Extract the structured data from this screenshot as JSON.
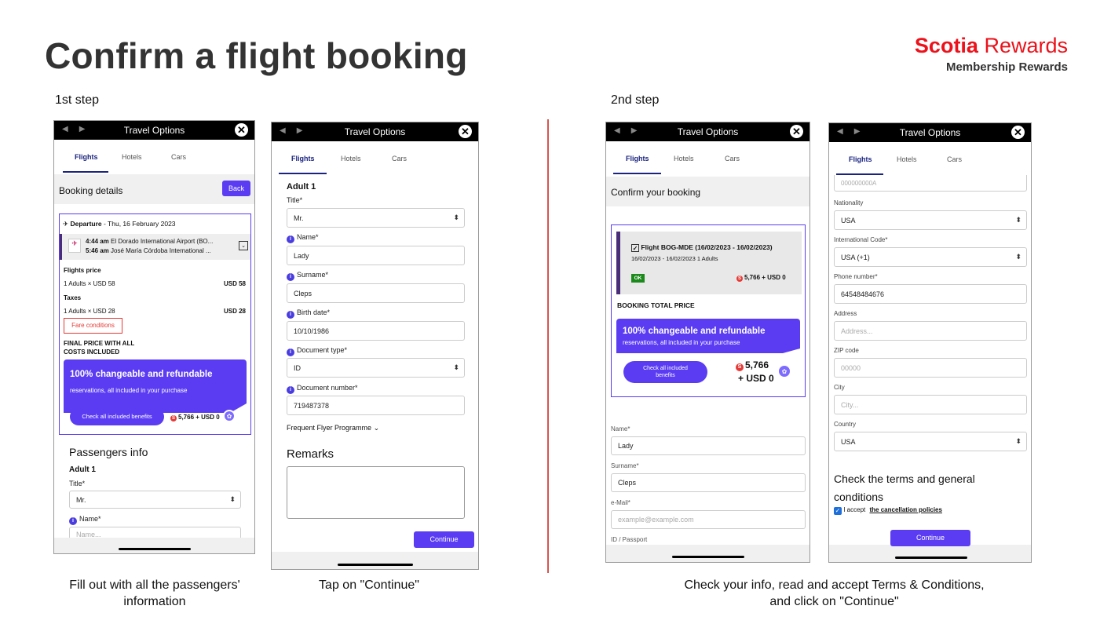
{
  "heading": "Confirm a flight booking",
  "brand": {
    "name_bold": "Scotia",
    "name_rest": " Rewards",
    "sub": "Membership Rewards"
  },
  "steps": {
    "s1": "1st step",
    "s2": "2nd step"
  },
  "captions": {
    "c1": "Fill out with all the passengers' information",
    "c2": "Tap on \"Continue\"",
    "c3a": "Check your info, read and accept Terms & Conditions,",
    "c3b": "and click on \"Continue\""
  },
  "app": {
    "title": "Travel Options",
    "tab_flights": "Flights",
    "tab_hotels": "Hotels",
    "tab_cars": "Cars",
    "close": "✕"
  },
  "p1": {
    "booking_details": "Booking details",
    "back": "Back",
    "departure_label": "Departure",
    "departure_date": " - Thu, 16 February 2023",
    "dep_time": "4:44 am",
    "dep_place": " El Dorado International Airport (BO...",
    "arr_time": "5:46 am",
    "arr_place": " José María Córdoba International ...",
    "flights_price": "Flights price",
    "fp_line": "1 Adults × USD 58",
    "fp_val": "USD 58",
    "taxes": "Taxes",
    "tx_line": "1 Adults × USD 28",
    "tx_val": "USD 28",
    "fare_conditions": "Fare conditions",
    "final1": "FINAL PRICE WITH ALL",
    "final2": "COSTS INCLUDED",
    "promo_title": "100% changeable and refundable",
    "promo_sub": "reservations, all included in your purchase",
    "benefits": "Check all included benefits",
    "price": "5,766 + USD 0",
    "pass_info": "Passengers info",
    "adult": "Adult 1",
    "title_lbl": "Title*",
    "title_val": "Mr.",
    "name_lbl": "Name*",
    "name_ph": "Name..."
  },
  "p2": {
    "adult": "Adult 1",
    "title_lbl": "Title*",
    "title_val": "Mr.",
    "name_lbl": "Name*",
    "name_val": "Lady",
    "surname_lbl": "Surname*",
    "surname_val": "Cleps",
    "birth_lbl": "Birth date*",
    "birth_val": "10/10/1986",
    "doctype_lbl": "Document type*",
    "doctype_val": "ID",
    "docnum_lbl": "Document number*",
    "docnum_val": "719487378",
    "ffp": "Frequent Flyer Programme",
    "remarks": "Remarks",
    "continue": "Continue"
  },
  "p3": {
    "confirm": "Confirm your booking",
    "flight_line": "Flight BOG-MDE (16/02/2023 - 16/02/2023)",
    "flight_sub": "16/02/2023 - 16/02/2023 1 Adults",
    "ok": "OK",
    "price": "5,766 + USD 0",
    "total": "BOOKING TOTAL PRICE",
    "promo_title": "100% changeable and refundable",
    "promo_sub": "reservations, all included in your purchase",
    "benefits1": "Check all included",
    "benefits2": "benefits",
    "big_price1": "5,766",
    "big_price2": "+ USD 0",
    "name_lbl": "Name*",
    "name_val": "Lady",
    "surname_lbl": "Surname*",
    "surname_val": "Cleps",
    "email_lbl": "e-Mail*",
    "email_ph": "example@example.com",
    "passport_lbl": "ID / Passport"
  },
  "p4": {
    "id_ph": "000000000A",
    "nat_lbl": "Nationality",
    "nat_val": "USA",
    "intl_lbl": "International Code*",
    "intl_val": "USA (+1)",
    "phone_lbl": "Phone number*",
    "phone_val": "64548484676",
    "addr_lbl": "Address",
    "addr_ph": "Address...",
    "zip_lbl": "ZIP code",
    "zip_ph": "00000",
    "city_lbl": "City",
    "city_ph": "City...",
    "country_lbl": "Country",
    "country_val": "USA",
    "terms1": "Check the terms and general",
    "terms2": "conditions",
    "accept": "I accept",
    "policies": "the cancellation policies",
    "continue": "Continue"
  }
}
